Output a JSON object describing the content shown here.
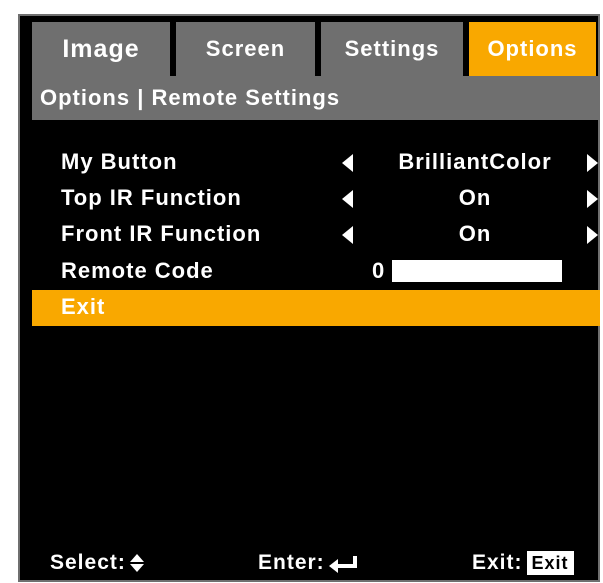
{
  "tabs": [
    {
      "label": "Image"
    },
    {
      "label": "Screen"
    },
    {
      "label": "Settings"
    },
    {
      "label": "Options",
      "active": true
    }
  ],
  "breadcrumb": "Options | Remote Settings",
  "rows": {
    "my_button": {
      "label": "My Button",
      "value": "BrilliantColor"
    },
    "top_ir": {
      "label": "Top IR Function",
      "value": "On"
    },
    "front_ir": {
      "label": "Front IR Function",
      "value": "On"
    },
    "remote_code": {
      "label": "Remote Code",
      "value": "0"
    },
    "exit": {
      "label": "Exit"
    }
  },
  "footer": {
    "select_label": "Select:",
    "enter_label": "Enter:",
    "exit_label": "Exit:",
    "exit_key": "Exit"
  },
  "colors": {
    "accent": "#f9a800",
    "tab_gray": "#6f6f6f",
    "background": "#000000",
    "text": "#ffffff"
  },
  "icons": [
    "arrow-left-icon",
    "arrow-right-icon",
    "updown-icon",
    "enter-icon"
  ]
}
